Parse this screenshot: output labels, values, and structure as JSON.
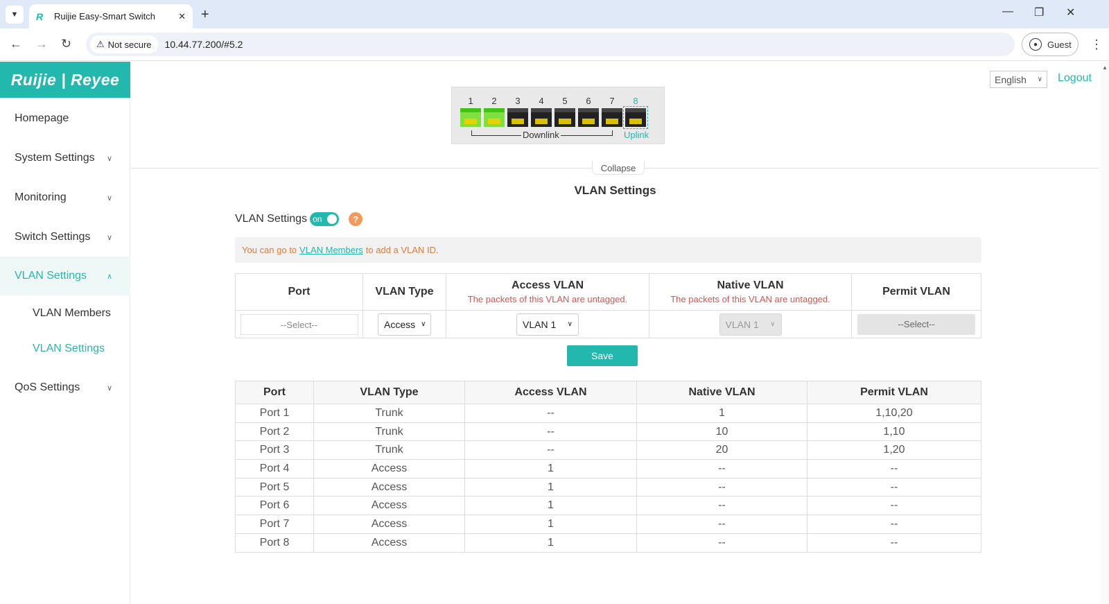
{
  "browser": {
    "tab_title": "Ruijie Easy-Smart Switch",
    "tab_close": "✕",
    "new_tab": "+",
    "security_label": "Not secure",
    "url": "10.44.77.200/#5.2",
    "profile_label": "Guest"
  },
  "sidebar": {
    "logo": "Ruijie | Reyee",
    "items": [
      {
        "label": "Homepage"
      },
      {
        "label": "System Settings"
      },
      {
        "label": "Monitoring"
      },
      {
        "label": "Switch Settings"
      },
      {
        "label": "VLAN Settings"
      },
      {
        "label": "QoS Settings"
      }
    ],
    "sub_items": [
      {
        "label": "VLAN Members"
      },
      {
        "label": "VLAN Settings"
      }
    ]
  },
  "header": {
    "language": "English",
    "logout": "Logout"
  },
  "ports": {
    "numbers": [
      "1",
      "2",
      "3",
      "4",
      "5",
      "6",
      "7",
      "8"
    ],
    "link_up": [
      true,
      true,
      false,
      false,
      false,
      false,
      false,
      false
    ],
    "downlink_label": "Downlink",
    "uplink_label": "Uplink"
  },
  "collapse_label": "Collapse",
  "page_title": "VLAN Settings",
  "vlan_settings": {
    "label": "VLAN Settings",
    "toggle_text": "on",
    "help": "?"
  },
  "notice": {
    "prefix": "You can go to",
    "link": "VLAN Members",
    "suffix": "to add a VLAN ID."
  },
  "config_table": {
    "headers": {
      "port": "Port",
      "vlan_type": "VLAN Type",
      "access_vlan": "Access VLAN",
      "access_note": "The packets of this VLAN are untagged.",
      "native_vlan": "Native VLAN",
      "native_note": "The packets of this VLAN are untagged.",
      "permit_vlan": "Permit VLAN"
    },
    "port_placeholder": "--Select--",
    "vlan_type_value": "Access",
    "access_vlan_value": "VLAN 1",
    "native_vlan_value": "VLAN 1",
    "permit_vlan_value": "--Select--"
  },
  "save_label": "Save",
  "summary_table": {
    "headers": [
      "Port",
      "VLAN Type",
      "Access VLAN",
      "Native VLAN",
      "Permit VLAN"
    ],
    "rows": [
      [
        "Port 1",
        "Trunk",
        "--",
        "1",
        "1,10,20"
      ],
      [
        "Port 2",
        "Trunk",
        "--",
        "10",
        "1,10"
      ],
      [
        "Port 3",
        "Trunk",
        "--",
        "20",
        "1,20"
      ],
      [
        "Port 4",
        "Access",
        "1",
        "--",
        "--"
      ],
      [
        "Port 5",
        "Access",
        "1",
        "--",
        "--"
      ],
      [
        "Port 6",
        "Access",
        "1",
        "--",
        "--"
      ],
      [
        "Port 7",
        "Access",
        "1",
        "--",
        "--"
      ],
      [
        "Port 8",
        "Access",
        "1",
        "--",
        "--"
      ]
    ]
  },
  "colors": {
    "accent": "#23b8ad",
    "notice_text": "#e07a3c",
    "warning_text": "#d9534f",
    "help_icon": "#f39a5b"
  }
}
